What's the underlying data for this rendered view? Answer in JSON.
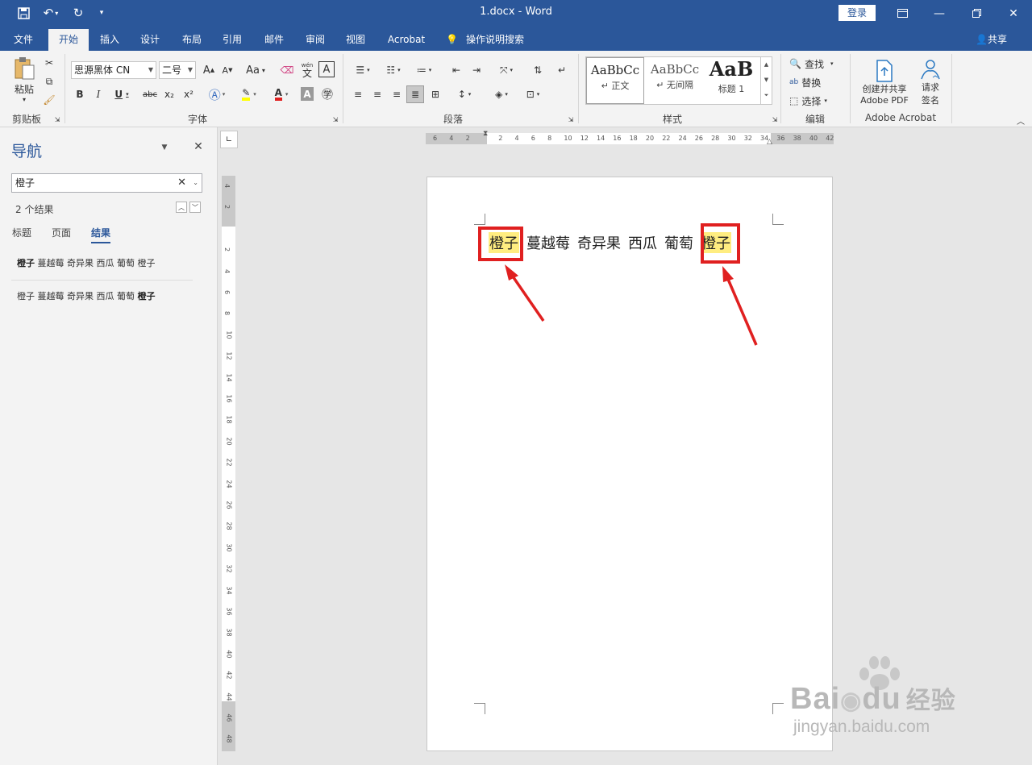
{
  "app": {
    "title": "1.docx  -  Word",
    "login": "登录",
    "window_buttons": [
      "ribbon-display-icon",
      "minimize-icon",
      "restore-icon",
      "close-icon"
    ]
  },
  "quick_access": [
    "save-icon",
    "undo-icon",
    "redo-icon",
    "customize-icon"
  ],
  "tabs": [
    "文件",
    "开始",
    "插入",
    "设计",
    "布局",
    "引用",
    "邮件",
    "审阅",
    "视图",
    "Acrobat"
  ],
  "active_tab": "开始",
  "tell_me": "操作说明搜索",
  "share": "共享",
  "ribbon": {
    "clipboard": {
      "paste": "粘贴",
      "label": "剪贴板"
    },
    "font": {
      "font_name": "思源黑体 CN",
      "font_size": "二号",
      "label": "字体",
      "btn_grow": "A",
      "btn_shrink": "A",
      "btn_case": "Aa",
      "btn_bold": "B",
      "btn_italic": "I",
      "btn_underline": "U",
      "btn_strike": "abc",
      "btn_sub": "x₂",
      "btn_sup": "x²",
      "btn_box": "A",
      "btn_pinyin": "wén",
      "btn_pinyin_char": "文"
    },
    "paragraph": {
      "label": "段落"
    },
    "styles": {
      "label": "样式",
      "items": [
        {
          "preview": "AaBbCc",
          "name": "正文"
        },
        {
          "preview": "AaBbCc",
          "name": "无间隔"
        },
        {
          "preview": "AaB",
          "name": "标题 1"
        }
      ]
    },
    "editing": {
      "find": "查找",
      "replace": "替换",
      "select": "选择",
      "label": "编辑"
    },
    "acrobat": {
      "create_share": "创建并共享",
      "adobe_pdf": "Adobe PDF",
      "request": "请求",
      "sign": "签名",
      "label": "Adobe Acrobat"
    }
  },
  "nav": {
    "title": "导航",
    "search_value": "橙子",
    "result_count": "2 个结果",
    "tabs": [
      "标题",
      "页面",
      "结果"
    ],
    "active_tab": "结果",
    "results": [
      {
        "bold": "橙子",
        "rest": " 蔓越莓 奇异果 西瓜 葡萄 橙子",
        "bold_first": true
      },
      {
        "rest": "橙子 蔓越莓 奇异果 西瓜 葡萄 ",
        "bold": "橙子",
        "bold_first": false
      }
    ]
  },
  "ruler_h": [
    "6",
    "4",
    "2",
    "",
    "2",
    "4",
    "6",
    "8",
    "10",
    "12",
    "14",
    "16",
    "18",
    "20",
    "22",
    "24",
    "26",
    "28",
    "30",
    "32",
    "34",
    "36",
    "38",
    "40",
    "42"
  ],
  "ruler_v": [
    "4",
    "2",
    "",
    "2",
    "4",
    "6",
    "8",
    "10",
    "12",
    "14",
    "16",
    "18",
    "20",
    "22",
    "24",
    "26",
    "28",
    "30",
    "32",
    "34",
    "36",
    "38",
    "40",
    "42",
    "44",
    "46",
    "48"
  ],
  "document": {
    "words": [
      "橙子",
      "蔓越莓",
      "奇异果",
      "西瓜",
      "葡萄",
      "橙子"
    ],
    "highlighted": [
      0,
      5
    ]
  },
  "watermark": {
    "brand": "Bai",
    "brand2": "du",
    "cn": "经验",
    "url": "jingyan.baidu.com"
  },
  "colors": {
    "word_blue": "#2b579a",
    "highlight": "#ffed80",
    "annotation_red": "#e02020"
  }
}
